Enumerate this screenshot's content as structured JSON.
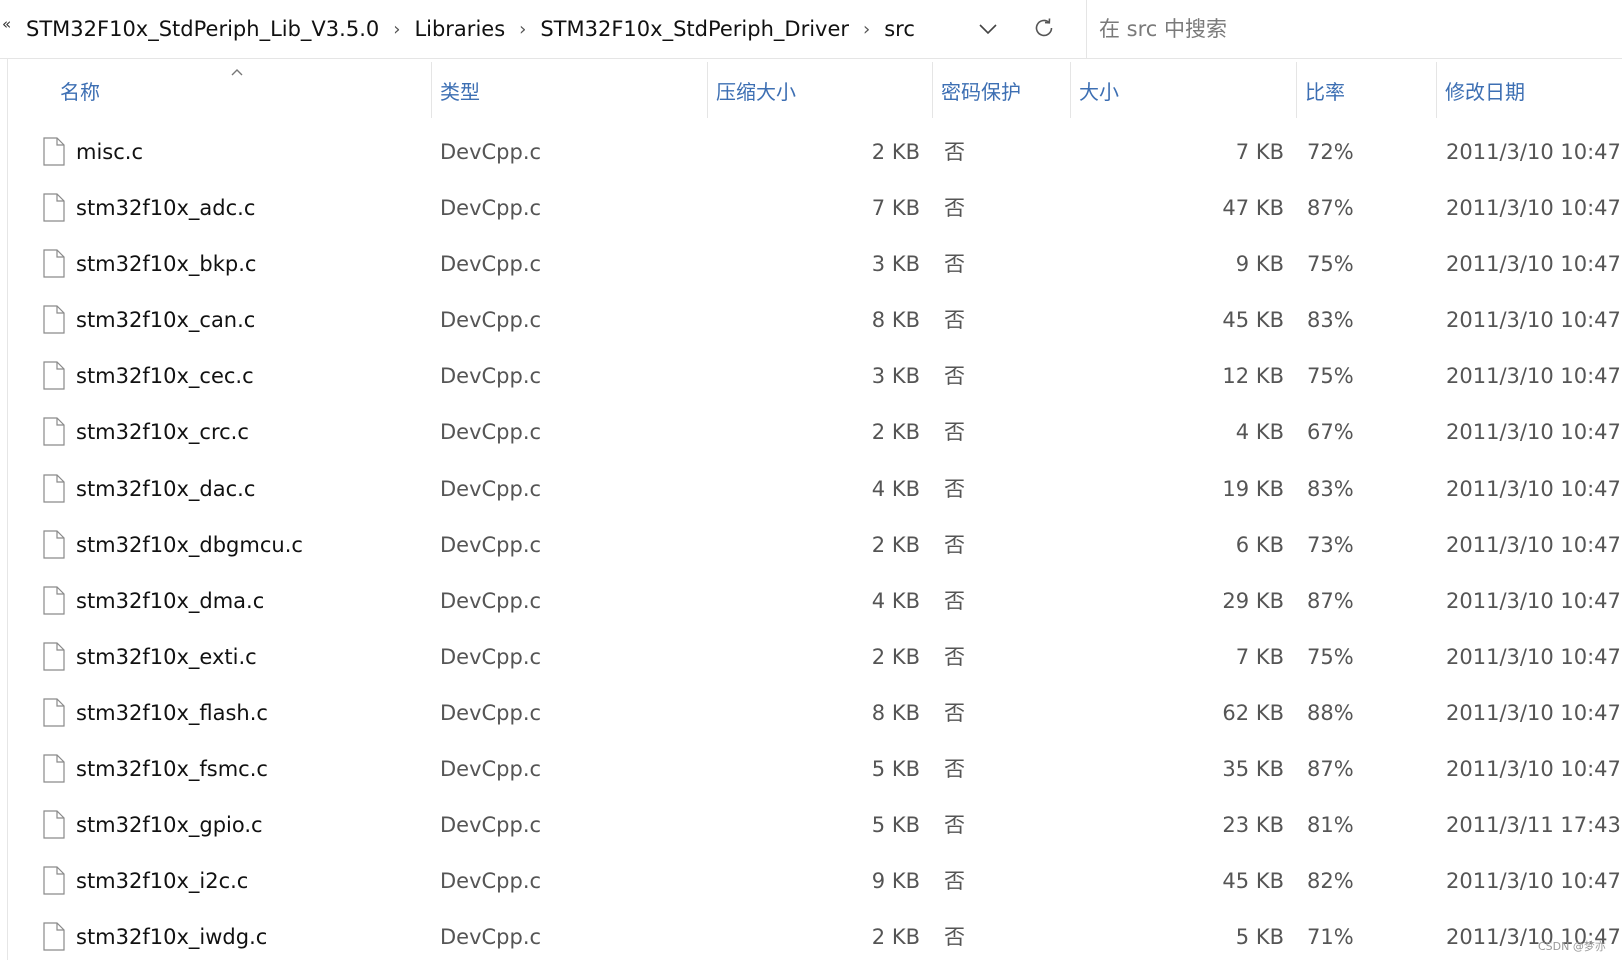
{
  "address_bar": {
    "overflow_glyph": "«",
    "breadcrumbs": [
      "STM32F10x_StdPeriph_Lib_V3.5.0",
      "Libraries",
      "STM32F10x_StdPeriph_Driver",
      "src"
    ],
    "separator": "›"
  },
  "search": {
    "placeholder": "在 src 中搜索",
    "value": ""
  },
  "columns": {
    "name": "名称",
    "type": "类型",
    "compressed_size": "压缩大小",
    "password_protected": "密码保护",
    "size": "大小",
    "ratio": "比率",
    "modified": "修改日期"
  },
  "sort": {
    "column": "name",
    "direction": "ascending"
  },
  "files": [
    {
      "name": "misc.c",
      "type": "DevCpp.c",
      "compressed_size": "2 KB",
      "password_protected": "否",
      "size": "7 KB",
      "ratio": "72%",
      "modified": "2011/3/10 10:47"
    },
    {
      "name": "stm32f10x_adc.c",
      "type": "DevCpp.c",
      "compressed_size": "7 KB",
      "password_protected": "否",
      "size": "47 KB",
      "ratio": "87%",
      "modified": "2011/3/10 10:47"
    },
    {
      "name": "stm32f10x_bkp.c",
      "type": "DevCpp.c",
      "compressed_size": "3 KB",
      "password_protected": "否",
      "size": "9 KB",
      "ratio": "75%",
      "modified": "2011/3/10 10:47"
    },
    {
      "name": "stm32f10x_can.c",
      "type": "DevCpp.c",
      "compressed_size": "8 KB",
      "password_protected": "否",
      "size": "45 KB",
      "ratio": "83%",
      "modified": "2011/3/10 10:47"
    },
    {
      "name": "stm32f10x_cec.c",
      "type": "DevCpp.c",
      "compressed_size": "3 KB",
      "password_protected": "否",
      "size": "12 KB",
      "ratio": "75%",
      "modified": "2011/3/10 10:47"
    },
    {
      "name": "stm32f10x_crc.c",
      "type": "DevCpp.c",
      "compressed_size": "2 KB",
      "password_protected": "否",
      "size": "4 KB",
      "ratio": "67%",
      "modified": "2011/3/10 10:47"
    },
    {
      "name": "stm32f10x_dac.c",
      "type": "DevCpp.c",
      "compressed_size": "4 KB",
      "password_protected": "否",
      "size": "19 KB",
      "ratio": "83%",
      "modified": "2011/3/10 10:47"
    },
    {
      "name": "stm32f10x_dbgmcu.c",
      "type": "DevCpp.c",
      "compressed_size": "2 KB",
      "password_protected": "否",
      "size": "6 KB",
      "ratio": "73%",
      "modified": "2011/3/10 10:47"
    },
    {
      "name": "stm32f10x_dma.c",
      "type": "DevCpp.c",
      "compressed_size": "4 KB",
      "password_protected": "否",
      "size": "29 KB",
      "ratio": "87%",
      "modified": "2011/3/10 10:47"
    },
    {
      "name": "stm32f10x_exti.c",
      "type": "DevCpp.c",
      "compressed_size": "2 KB",
      "password_protected": "否",
      "size": "7 KB",
      "ratio": "75%",
      "modified": "2011/3/10 10:47"
    },
    {
      "name": "stm32f10x_flash.c",
      "type": "DevCpp.c",
      "compressed_size": "8 KB",
      "password_protected": "否",
      "size": "62 KB",
      "ratio": "88%",
      "modified": "2011/3/10 10:47"
    },
    {
      "name": "stm32f10x_fsmc.c",
      "type": "DevCpp.c",
      "compressed_size": "5 KB",
      "password_protected": "否",
      "size": "35 KB",
      "ratio": "87%",
      "modified": "2011/3/10 10:47"
    },
    {
      "name": "stm32f10x_gpio.c",
      "type": "DevCpp.c",
      "compressed_size": "5 KB",
      "password_protected": "否",
      "size": "23 KB",
      "ratio": "81%",
      "modified": "2011/3/11 17:43"
    },
    {
      "name": "stm32f10x_i2c.c",
      "type": "DevCpp.c",
      "compressed_size": "9 KB",
      "password_protected": "否",
      "size": "45 KB",
      "ratio": "82%",
      "modified": "2011/3/10 10:47"
    },
    {
      "name": "stm32f10x_iwdg.c",
      "type": "DevCpp.c",
      "compressed_size": "2 KB",
      "password_protected": "否",
      "size": "5 KB",
      "ratio": "71%",
      "modified": "2011/3/10 10:47"
    }
  ],
  "icons": {
    "file": "file-icon",
    "dropdown": "chevron-down-icon",
    "refresh": "refresh-icon",
    "overflow": "double-chevron-left-icon",
    "sort": "sort-ascending-icon"
  },
  "colors": {
    "header_text": "#3d6fb3",
    "divider": "#e5e5e5"
  },
  "watermark": "CSDN @梦亦"
}
